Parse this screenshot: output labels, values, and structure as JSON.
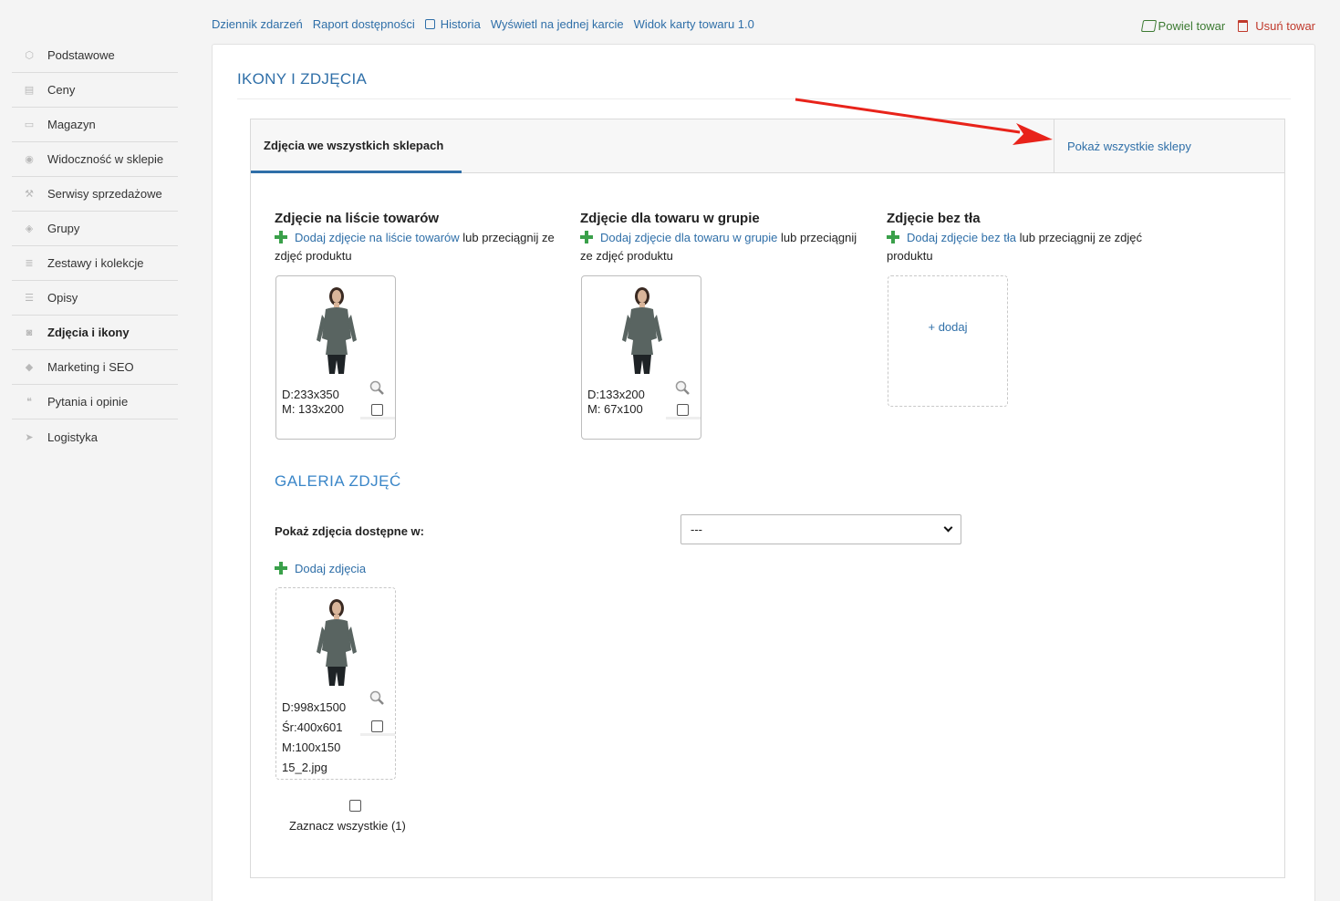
{
  "sidebar": {
    "items": [
      {
        "label": "Podstawowe",
        "icon": "cube-icon"
      },
      {
        "label": "Ceny",
        "icon": "coins-icon"
      },
      {
        "label": "Magazyn",
        "icon": "box-icon"
      },
      {
        "label": "Widoczność w sklepie",
        "icon": "eye-icon"
      },
      {
        "label": "Serwisy sprzedażowe",
        "icon": "hammer-icon"
      },
      {
        "label": "Grupy",
        "icon": "layers-icon"
      },
      {
        "label": "Zestawy i kolekcje",
        "icon": "stack-icon"
      },
      {
        "label": "Opisy",
        "icon": "text-icon"
      },
      {
        "label": "Zdjęcia i ikony",
        "icon": "camera-icon"
      },
      {
        "label": "Marketing i SEO",
        "icon": "tag-icon"
      },
      {
        "label": "Pytania i opinie",
        "icon": "comments-icon"
      },
      {
        "label": "Logistyka",
        "icon": "paper-plane-icon"
      }
    ]
  },
  "topnav": {
    "events": "Dziennik zdarzeń",
    "availability": "Raport dostępności",
    "history": "Historia",
    "single_card": "Wyświetl na jednej karcie",
    "card_view": "Widok karty towaru 1.0"
  },
  "actions": {
    "duplicate": "Powiel towar",
    "delete": "Usuń towar"
  },
  "card": {
    "title": "IKONY I ZDJĘCIA"
  },
  "tabs": {
    "active": "Zdjęcia we wszystkich sklepach",
    "show_all": "Pokaż wszystkie sklepy"
  },
  "columns": [
    {
      "title": "Zdjęcie na liście towarów",
      "add": "Dodaj zdjęcie",
      "target": "na liście towarów",
      "rest": "lub przeciągnij ze",
      "rest2": "zdjęć produktu",
      "dims_d": "D:233x350",
      "dims_m": "M: 133x200"
    },
    {
      "title": "Zdjęcie dla towaru w grupie",
      "add": "Dodaj zdjęcie",
      "target": "dla towaru w grupie",
      "rest": "lub przeciągnij",
      "rest2": "ze zdjęć produktu",
      "dims_d": "D:133x200",
      "dims_m": "M: 67x100"
    },
    {
      "title": "Zdjęcie bez tła",
      "add": "Dodaj zdjęcie",
      "target": "bez tła",
      "rest": "lub przeciągnij ze zdjęć",
      "rest2": "produktu",
      "add_box": "+ dodaj"
    }
  ],
  "gallery": {
    "title": "GALERIA ZDJĘĆ",
    "show_label": "Pokaż zdjęcia dostępne w:",
    "select_value": "---",
    "add_photos": "Dodaj zdjęcia",
    "photo": {
      "d": "D:998x1500",
      "sr": "Śr:400x601",
      "m": "M:100x150",
      "file": "15_2.jpg"
    },
    "select_all": "Zaznacz wszystkie (1)"
  },
  "colors": {
    "link": "#2f6fa8",
    "gallery_title": "#3a86c8",
    "green": "#3c7a32",
    "red": "#c0392b",
    "arrow": "#e8231a"
  }
}
